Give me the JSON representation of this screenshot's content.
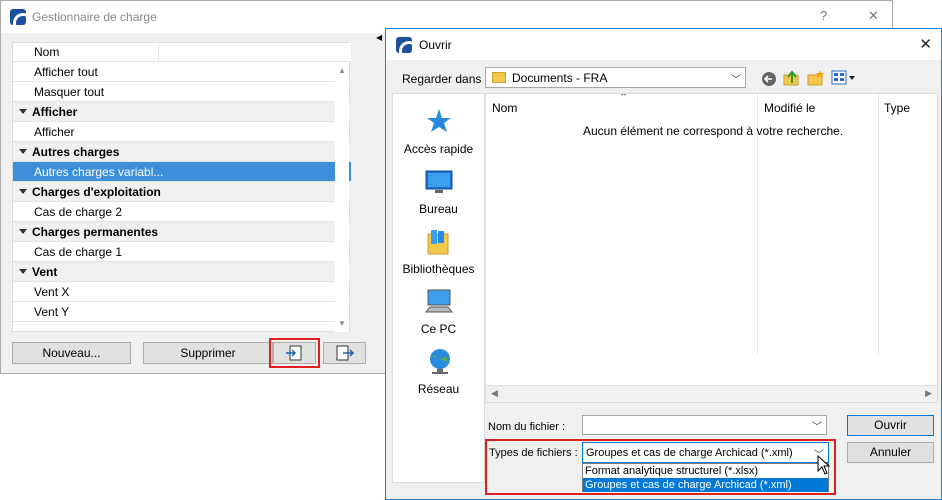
{
  "load_manager": {
    "title": "Gestionnaire de charge",
    "help_label": "?",
    "close_label": "✕",
    "column_name": "Nom",
    "rows": [
      {
        "label": "Afficher tout",
        "type": "item"
      },
      {
        "label": "Masquer tout",
        "type": "item"
      },
      {
        "label": "Afficher",
        "type": "group"
      },
      {
        "label": "Afficher",
        "type": "item"
      },
      {
        "label": "Autres charges",
        "type": "group"
      },
      {
        "label": "Autres charges variabl...",
        "type": "item",
        "selected": true
      },
      {
        "label": "Charges d'exploitation",
        "type": "group"
      },
      {
        "label": "Cas de charge 2",
        "type": "item"
      },
      {
        "label": "Charges permanentes",
        "type": "group"
      },
      {
        "label": "Cas de charge 1",
        "type": "item"
      },
      {
        "label": "Vent",
        "type": "group"
      },
      {
        "label": "Vent X",
        "type": "item"
      },
      {
        "label": "Vent Y",
        "type": "item"
      }
    ],
    "buttons": {
      "new": "Nouveau...",
      "delete": "Supprimer"
    }
  },
  "open_dialog": {
    "title": "Ouvrir",
    "look_in_label": "Regarder dans :",
    "look_in_value": "Documents - FRA",
    "columns": {
      "name": "Nom",
      "modified": "Modifié le",
      "type": "Type"
    },
    "empty_message": "Aucun élément ne correspond à votre recherche.",
    "places": [
      "Accès rapide",
      "Bureau",
      "Bibliothèques",
      "Ce PC",
      "Réseau"
    ],
    "filename_label": "Nom du fichier :",
    "filename_value": "",
    "filetype_label": "Types de fichiers :",
    "filetype_value": "Groupes et cas de charge Archicad (*.xml)",
    "filetype_options": [
      "Format analytique structurel (*.xlsx)",
      "Groupes et cas de charge Archicad (*.xml)"
    ],
    "open_button": "Ouvrir",
    "cancel_button": "Annuler"
  },
  "colors": {
    "selection": "#3c8fd9",
    "highlight_box": "#e02020",
    "dialog_accent": "#0078d7",
    "app_icon": "#1c4f9c"
  },
  "icons": [
    "app-icon",
    "quick-access-star-icon",
    "desktop-icon",
    "libraries-icon",
    "this-pc-icon",
    "network-icon",
    "back-icon",
    "up-folder-icon",
    "new-folder-icon",
    "view-menu-icon",
    "import-icon",
    "export-icon",
    "mouse-cursor-icon"
  ]
}
